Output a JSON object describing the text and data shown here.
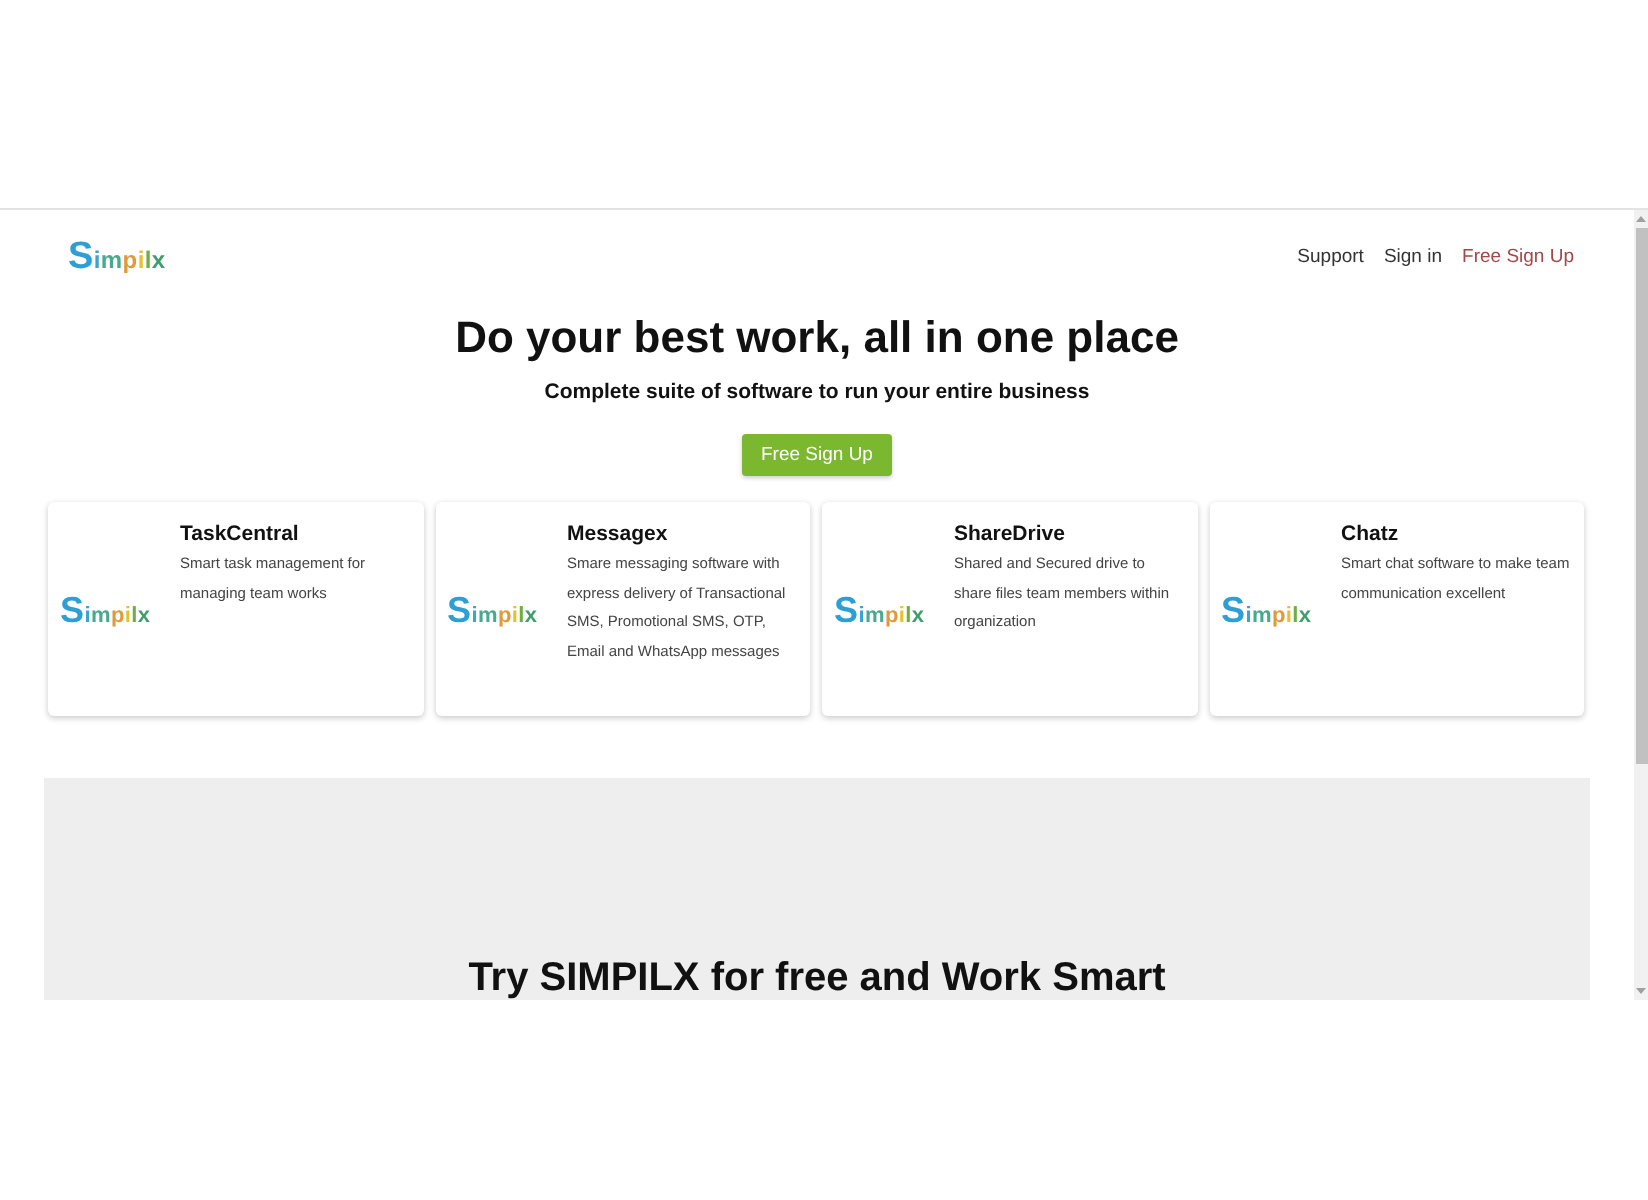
{
  "logo": "Simpilx",
  "nav": [
    {
      "label": "Support",
      "kind": "link"
    },
    {
      "label": "Sign in",
      "kind": "link"
    },
    {
      "label": "Free Sign Up",
      "kind": "signup"
    }
  ],
  "hero": {
    "title": "Do your best work, all in one place",
    "subtitle": "Complete suite of software to run your entire business",
    "button": "Free Sign Up"
  },
  "products": [
    {
      "logo": "Simpilx",
      "name": "TaskCentral",
      "description": "Smart task management for managing team works"
    },
    {
      "logo": "Simpilx",
      "name": "Messagex",
      "description": "Smare messaging software with express delivery of Transactional SMS, Promotional SMS, OTP, Email and WhatsApp messages"
    },
    {
      "logo": "Simpilx",
      "name": "ShareDrive",
      "description": "Shared and Secured drive to share files team members within organization"
    },
    {
      "logo": "Simpilx",
      "name": "Chatz",
      "description": "Smart chat software to make team communication excellent"
    }
  ],
  "cta": {
    "title": "Try SIMPILX for free and Work Smart"
  }
}
